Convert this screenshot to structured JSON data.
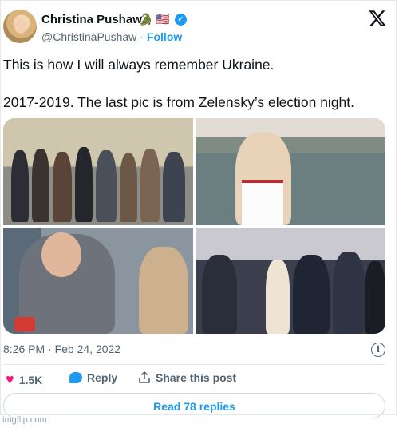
{
  "author": {
    "name": "Christina Pushaw",
    "flags": "🐊 🇺🇸",
    "handle": "@ChristinaPushaw",
    "follow_label": "Follow"
  },
  "tweet": {
    "line1": "This is how I will always remember Ukraine.",
    "line2": "2017-2019. The last pic is from Zelensky’s election night.",
    "timestamp": "8:26 PM · Feb 24, 2022"
  },
  "actions": {
    "like_count": "1.5K",
    "reply_label": "Reply",
    "share_label": "Share this post",
    "read_replies_label": "Read 78 replies"
  },
  "watermark": "imgflip.com",
  "colors": {
    "accent": "#1d9bf0",
    "like": "#f91880",
    "muted": "#536471"
  }
}
